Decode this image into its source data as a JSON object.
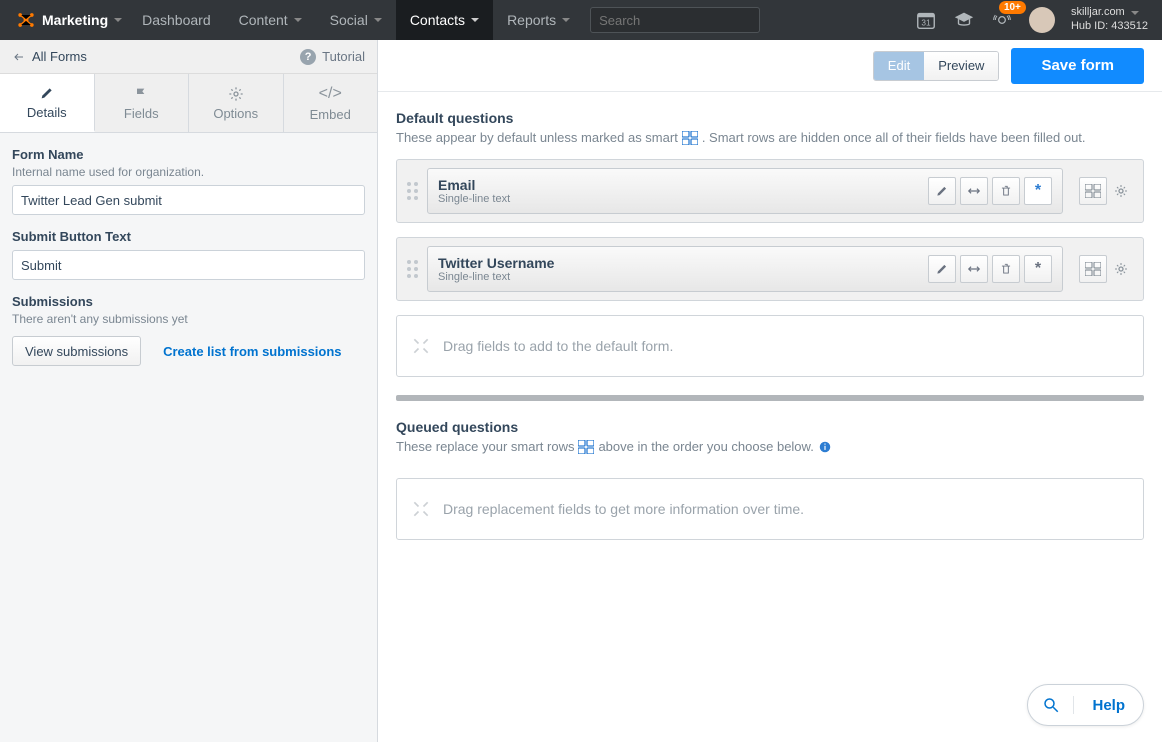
{
  "topnav": {
    "brand": "Marketing",
    "items": [
      "Dashboard",
      "Content",
      "Social",
      "Contacts",
      "Reports"
    ],
    "active_index": 3,
    "search_placeholder": "Search",
    "notification_count": "10+",
    "account_name": "skilljar.com",
    "hub_id_label": "Hub ID: 433512",
    "calendar_day": "31"
  },
  "subheader": {
    "back_label": "All Forms",
    "tutorial_label": "Tutorial"
  },
  "sidetabs": {
    "items": [
      "Details",
      "Fields",
      "Options",
      "Embed"
    ],
    "active_index": 0
  },
  "form": {
    "name_label": "Form Name",
    "name_help": "Internal name used for organization.",
    "name_value": "Twitter Lead Gen submit",
    "submit_label": "Submit Button Text",
    "submit_value": "Submit"
  },
  "submissions": {
    "title": "Submissions",
    "empty_text": "There aren't any submissions yet",
    "view_button": "View submissions",
    "create_link": "Create list from submissions"
  },
  "editor": {
    "edit_label": "Edit",
    "preview_label": "Preview",
    "save_label": "Save form",
    "default_title": "Default questions",
    "default_desc1": "These appear by default unless marked as smart",
    "default_desc2": ". Smart rows are hidden once all of their fields have been filled out.",
    "fields": [
      {
        "name": "Email",
        "type": "Single-line text",
        "required_active": true
      },
      {
        "name": "Twitter Username",
        "type": "Single-line text",
        "required_active": false
      }
    ],
    "dropzone_default": "Drag fields to add to the default form.",
    "queued_title": "Queued questions",
    "queued_desc1": "These replace your smart rows",
    "queued_desc2": "above in the order you choose below.",
    "dropzone_queued": "Drag replacement fields to get more information over time."
  },
  "help": {
    "label": "Help"
  }
}
